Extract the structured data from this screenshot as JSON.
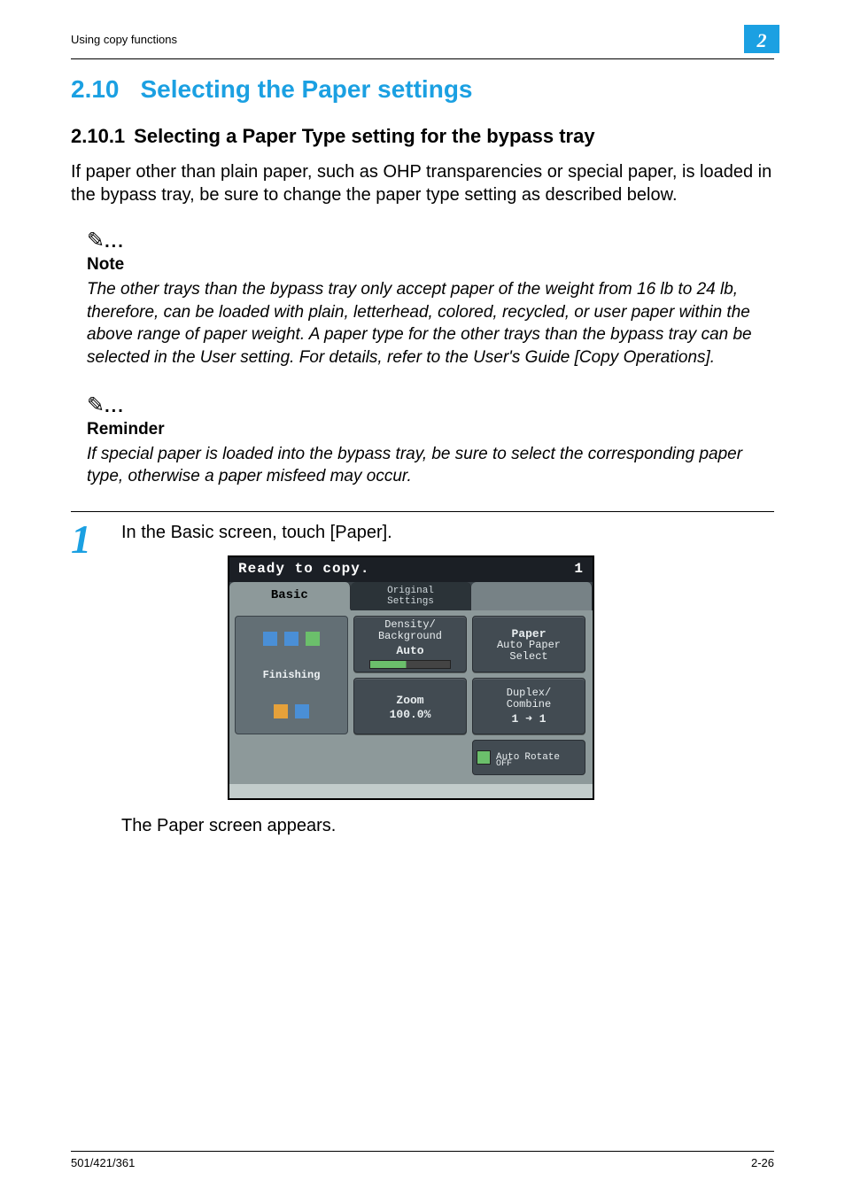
{
  "header": {
    "running": "Using copy functions",
    "chapter_badge": "2"
  },
  "section": {
    "number": "2.10",
    "title": "Selecting the Paper settings"
  },
  "subsection": {
    "number": "2.10.1",
    "title": "Selecting a Paper Type setting for the bypass tray"
  },
  "intro": "If paper other than plain paper, such as OHP transparencies or special paper, is loaded in the bypass tray, be sure to change the paper type setting as described below.",
  "note": {
    "label": "Note",
    "body": "The other trays than the bypass tray only accept paper of the weight from 16 lb to 24 lb, therefore, can be loaded with plain, letterhead, colored, recycled, or user paper within the above range of paper weight. A paper type for the other trays than the bypass tray can be selected in the User setting. For details, refer to the User's Guide [Copy Operations]."
  },
  "reminder": {
    "label": "Reminder",
    "body": "If special paper is loaded into the bypass tray, be sure to select the corresponding paper type, otherwise a paper misfeed may occur."
  },
  "step": {
    "number": "1",
    "text": "In the Basic screen, touch [Paper].",
    "result": "The Paper screen appears."
  },
  "lcd": {
    "status": "Ready to copy.",
    "copies": "1",
    "tabs": {
      "basic": "Basic",
      "orig1": "Original",
      "orig2": "Settings"
    },
    "density": {
      "title": "Density/\nBackground",
      "value": "Auto"
    },
    "paper": {
      "title": "Paper",
      "value": "Auto Paper\nSelect"
    },
    "zoom": {
      "title": "Zoom",
      "value": "100.0%"
    },
    "duplex": {
      "title": "Duplex/\nCombine",
      "value": "1 ➜ 1"
    },
    "finishing": "Finishing",
    "autorotate": {
      "l1": "Auto",
      "l2": "OFF",
      "l3": "Rotate"
    }
  },
  "footer": {
    "left": "501/421/361",
    "right": "2-26"
  }
}
